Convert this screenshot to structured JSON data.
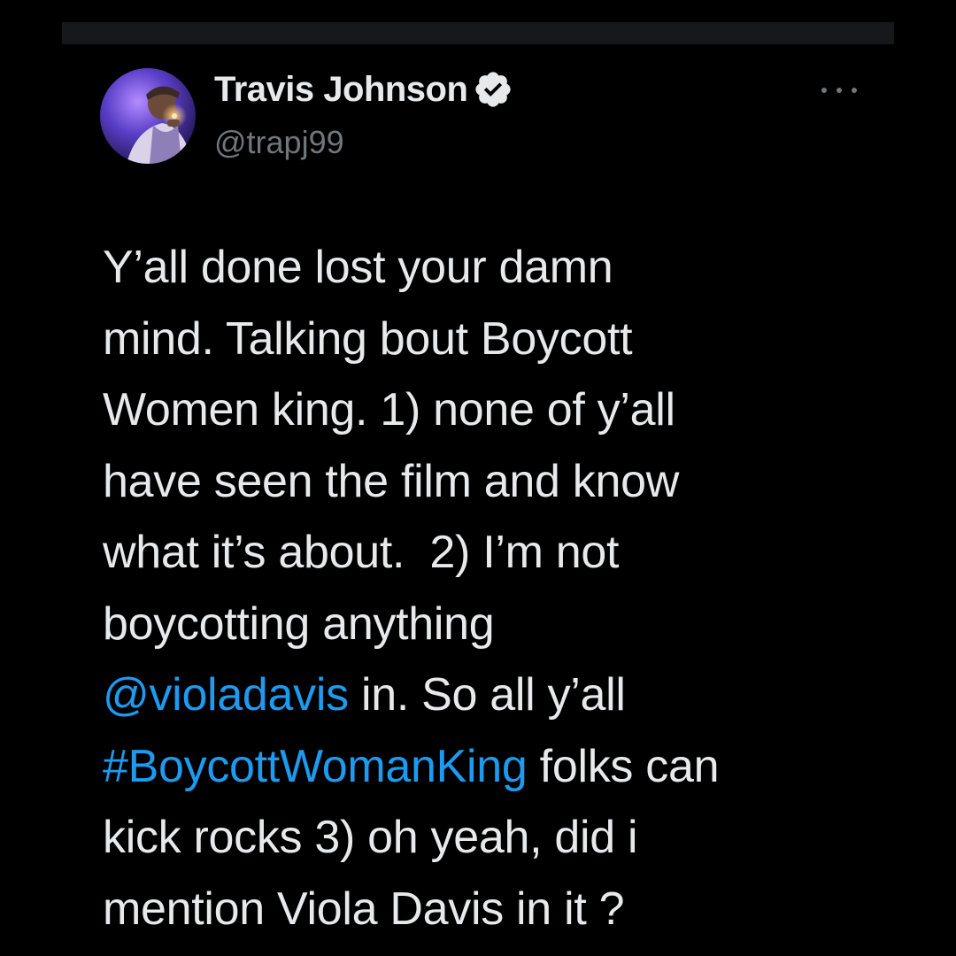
{
  "theme": {
    "background": "#000000",
    "text_primary": "#e7e9ea",
    "text_secondary": "#71767b",
    "link_color": "#1d9bf0",
    "verified_badge_color": "#e7e9ea"
  },
  "author": {
    "display_name": "Travis Johnson",
    "handle": "@trapj99",
    "verified": true,
    "avatar_icon": "profile-photo"
  },
  "actions": {
    "more_icon": "more-horizontal-icon"
  },
  "tweet": {
    "lines": [
      {
        "pre": "Y’all done lost your damn"
      },
      {
        "pre": "mind. Talking bout Boycott"
      },
      {
        "pre": "Women king. 1) none of y’all"
      },
      {
        "pre": "have seen the film and know"
      },
      {
        "pre": "what it’s about.  2) I’m not"
      },
      {
        "pre": "boycotting anything"
      },
      {
        "link": "@violadavis",
        "post": " in. So all y’all"
      },
      {
        "link": "#BoycottWomanKing",
        "post": " folks can"
      },
      {
        "pre": "kick rocks 3) oh yeah, did i"
      },
      {
        "pre": "mention Viola Davis in it ?"
      }
    ]
  }
}
